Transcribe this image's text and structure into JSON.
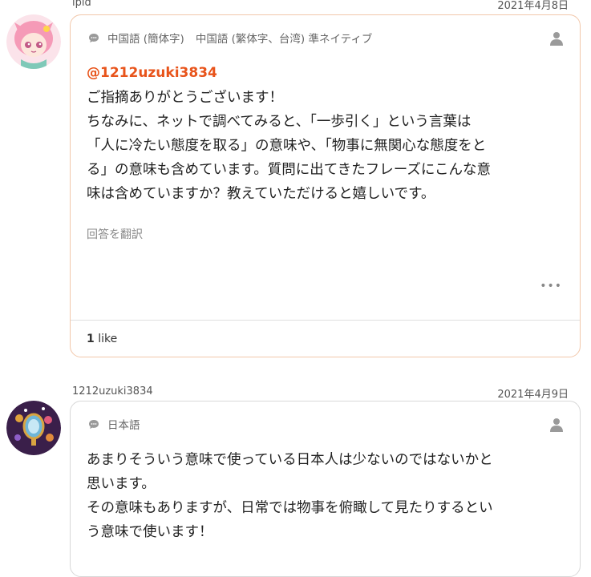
{
  "answer1": {
    "username": "ipid",
    "date": "2021年4月8日",
    "languages": [
      "中国語 (簡体字)",
      "中国語 (繁体字、台湾) 準ネイティブ"
    ],
    "mention": "@1212uzuki3834",
    "body": "ご指摘ありがとうございます！\nちなみに、ネットで調べてみると、「一歩引く」という言葉は\n「人に冷たい態度を取る」の意味や、「物事に無関心な態度をと\nる」の意味も含めています。質問に出てきたフレーズにこんな意\n味は含めていますか？教えていただけると嬉しいです。",
    "translate_label": "回答を翻訳",
    "more_label": "•••",
    "like_count": "1",
    "like_label": "like"
  },
  "answer2": {
    "username": "1212uzuki3834",
    "date": "2021年4月9日",
    "languages": [
      "日本語"
    ],
    "body": "あまりそういう意味で使っている日本人は少ないのではないかと\n思います。\nその意味もありますが、日常では物事を俯瞰して見たりするとい\nう意味で使います！"
  },
  "colors": {
    "accent": "#e8541b",
    "card_border_highlight": "#f2c7aa",
    "card_border": "#d8d8d8"
  }
}
